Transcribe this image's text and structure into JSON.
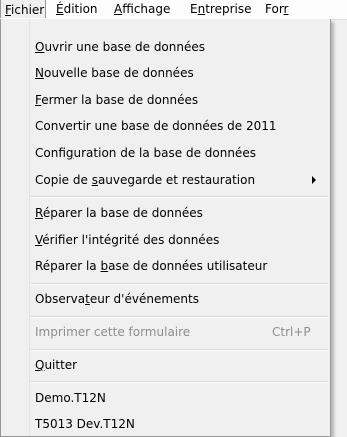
{
  "menubar": {
    "items": [
      {
        "pre": "",
        "mn": "F",
        "post": "ichier"
      },
      {
        "pre": "",
        "mn": "É",
        "post": "dition"
      },
      {
        "pre": "",
        "mn": "A",
        "post": "ffichage"
      },
      {
        "pre": "E",
        "mn": "n",
        "post": "treprise"
      },
      {
        "pre": "For",
        "mn": "",
        "post": "r"
      }
    ]
  },
  "menu": {
    "items": [
      {
        "pre": "",
        "mn": "O",
        "post": "uvrir une base de données"
      },
      {
        "pre": "",
        "mn": "N",
        "post": "ouvelle base de données"
      },
      {
        "pre": "",
        "mn": "F",
        "post": "ermer la base de données"
      },
      {
        "pre": "Convertir une base de données de 2011",
        "mn": "",
        "post": ""
      },
      {
        "pre": "Confi",
        "mn": "g",
        "post": "uration de la base de données"
      },
      {
        "pre": "Copie de ",
        "mn": "s",
        "post": "auvegarde et restauration"
      },
      {
        "pre": "",
        "mn": "R",
        "post": "éparer la base de données"
      },
      {
        "pre": "",
        "mn": "V",
        "post": "érifier l'intégrité des données"
      },
      {
        "pre": "Réparer la ",
        "mn": "b",
        "post": "ase de données utilisateur"
      },
      {
        "pre": "Observa",
        "mn": "t",
        "post": "eur d'événements"
      },
      {
        "pre": "Imprimer cette formulaire",
        "mn": "",
        "post": ""
      },
      {
        "pre": "",
        "mn": "Q",
        "post": "uitter"
      },
      {
        "pre": "Demo.T12N",
        "mn": "",
        "post": ""
      },
      {
        "pre": "T5013 Dev.T12N",
        "mn": "",
        "post": ""
      }
    ],
    "print_shortcut": "Ctrl+P"
  },
  "icons": {
    "submenu_arrow": "chevron-right-icon"
  }
}
